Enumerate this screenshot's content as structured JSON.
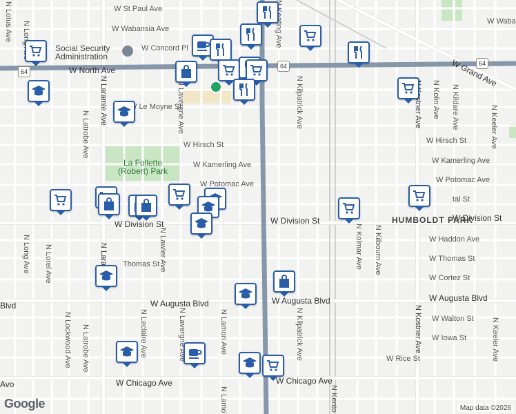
{
  "map": {
    "streets_h": [
      {
        "label": "W St Paul Ave",
        "name": "street-st-paul"
      },
      {
        "label": "W Wabansia Ave",
        "name": "street-wabansia"
      },
      {
        "label": "W Concord Pl",
        "name": "street-concord"
      },
      {
        "label": "W North Ave",
        "name": "street-north"
      },
      {
        "label": "W Grand Ave",
        "name": "street-grand"
      },
      {
        "label": "W Le Moyne St",
        "name": "street-lemoyne"
      },
      {
        "label": "W Hirsch St",
        "name": "street-hirsch-west"
      },
      {
        "label": "W Hirsch St",
        "name": "street-hirsch-east"
      },
      {
        "label": "W Kamerling Ave",
        "name": "street-kamerling-west"
      },
      {
        "label": "W Kamerling Ave",
        "name": "street-kamerling-east"
      },
      {
        "label": "W Potomac Ave",
        "name": "street-potomac-west"
      },
      {
        "label": "W Potomac Ave",
        "name": "street-potomac-east"
      },
      {
        "label": "W Division St",
        "name": "street-division-west"
      },
      {
        "label": "W Division St",
        "name": "street-division-mid"
      },
      {
        "label": "W Division St",
        "name": "street-division-east"
      },
      {
        "label": "W Haddon Ave",
        "name": "street-haddon"
      },
      {
        "label": "W Thomas St",
        "name": "street-thomas-east"
      },
      {
        "label": "Thomas St",
        "name": "street-thomas-west"
      },
      {
        "label": "W Cortez St",
        "name": "street-cortez"
      },
      {
        "label": "W Augusta Blvd",
        "name": "street-augusta-west"
      },
      {
        "label": "W Augusta Blvd",
        "name": "street-augusta-mid"
      },
      {
        "label": "W Augusta Blvd",
        "name": "street-augusta-east"
      },
      {
        "label": "Blvd",
        "name": "street-augusta-edge"
      },
      {
        "label": "W Walton St",
        "name": "street-walton"
      },
      {
        "label": "W Iowa St",
        "name": "street-iowa"
      },
      {
        "label": "W Rice St",
        "name": "street-rice"
      },
      {
        "label": "W Chicago Ave",
        "name": "street-chicago-west"
      },
      {
        "label": "W Chicago Ave",
        "name": "street-chicago-east"
      },
      {
        "label": "Avo",
        "name": "street-chicago-edge"
      },
      {
        "label": "W Waban",
        "name": "street-waban-east"
      },
      {
        "label": "tal St",
        "name": "street-tal-east"
      }
    ],
    "streets_v": [
      {
        "label": "N Lotus Ave",
        "name": "street-lotus"
      },
      {
        "label": "N Long Ave",
        "name": "street-long-north"
      },
      {
        "label": "N Long Ave",
        "name": "street-long-south"
      },
      {
        "label": "N Laramie Ave",
        "name": "street-laramie-north"
      },
      {
        "label": "N Laram",
        "name": "street-laramie-south"
      },
      {
        "label": "N Latrobe Ave",
        "name": "street-latrobe-north"
      },
      {
        "label": "N Latrobe Ave",
        "name": "street-latrobe-south"
      },
      {
        "label": "N Lockwood Ave",
        "name": "street-lockwood"
      },
      {
        "label": "N Lorel Ave",
        "name": "street-lorel"
      },
      {
        "label": "N Leclaire Ave",
        "name": "street-leclaire"
      },
      {
        "label": "N Lawler Ave",
        "name": "street-lawler"
      },
      {
        "label": "N Lavergne Ave",
        "name": "street-lavergne-north"
      },
      {
        "label": "N Lavergne Ave",
        "name": "street-lavergne-south"
      },
      {
        "label": "N Lamon Ave",
        "name": "street-lamon"
      },
      {
        "label": "N Lamo",
        "name": "street-lamon-edge"
      },
      {
        "label": "N Keating Ave",
        "name": "street-keating"
      },
      {
        "label": "N Kilpatrick Ave",
        "name": "street-kilpatrick-north"
      },
      {
        "label": "N Kilpatrick Ave",
        "name": "street-kilpatrick-south"
      },
      {
        "label": "N Kento",
        "name": "street-kenton"
      },
      {
        "label": "N Kolmar Ave",
        "name": "street-kolmar"
      },
      {
        "label": "N Kilbourn Ave",
        "name": "street-kilbourn"
      },
      {
        "label": "N Kostner Ave",
        "name": "street-kostner-north"
      },
      {
        "label": "N Kostner Ave",
        "name": "street-kostner-south"
      },
      {
        "label": "N Kolin Ave",
        "name": "street-kolin"
      },
      {
        "label": "N Kildare Ave",
        "name": "street-kildare"
      },
      {
        "label": "N Keeler Ave",
        "name": "street-keeler-north"
      },
      {
        "label": "N Keeler Ave",
        "name": "street-keeler-south"
      }
    ],
    "route_shields": [
      "64",
      "64",
      "64"
    ],
    "poi": {
      "ssa": "Social Security Administration"
    },
    "park": "La Follette (Robert) Park",
    "neighborhood": "HUMBOLDT PARK",
    "attribution": "Map data ©2026",
    "logo": "Google",
    "marker_colors": {
      "border": "#2a5da8",
      "fill": "#ffffff",
      "icon": "#2a5da8"
    },
    "markers": [
      {
        "icon": "restaurant-icon"
      },
      {
        "icon": "restaurant-icon"
      },
      {
        "icon": "shopping-cart-icon"
      },
      {
        "icon": "shopping-cart-icon"
      },
      {
        "icon": "cafe-icon"
      },
      {
        "icon": "restaurant-icon"
      },
      {
        "icon": "restaurant-icon"
      },
      {
        "icon": "shopping-bag-icon"
      },
      {
        "icon": "shopping-cart-icon"
      },
      {
        "icon": "restaurant-icon"
      },
      {
        "icon": "shopping-cart-icon"
      },
      {
        "icon": "school-icon"
      },
      {
        "icon": "school-icon"
      },
      {
        "icon": "restaurant-icon"
      },
      {
        "icon": "shopping-cart-icon"
      },
      {
        "icon": "shopping-cart-icon"
      },
      {
        "icon": "shopping-cart-icon"
      },
      {
        "icon": "shopping-bag-icon"
      },
      {
        "icon": "shopping-cart-icon"
      },
      {
        "icon": "school-icon"
      },
      {
        "icon": "school-icon"
      },
      {
        "icon": "school-icon"
      },
      {
        "icon": "shopping-bag-icon"
      },
      {
        "icon": "shopping-bag-icon"
      },
      {
        "icon": "shopping-cart-icon"
      },
      {
        "icon": "shopping-cart-icon"
      },
      {
        "icon": "school-icon"
      },
      {
        "icon": "shopping-bag-icon"
      },
      {
        "icon": "school-icon"
      },
      {
        "icon": "cafe-icon"
      },
      {
        "icon": "school-icon"
      },
      {
        "icon": "shopping-cart-icon"
      },
      {
        "icon": "school-icon"
      }
    ]
  }
}
